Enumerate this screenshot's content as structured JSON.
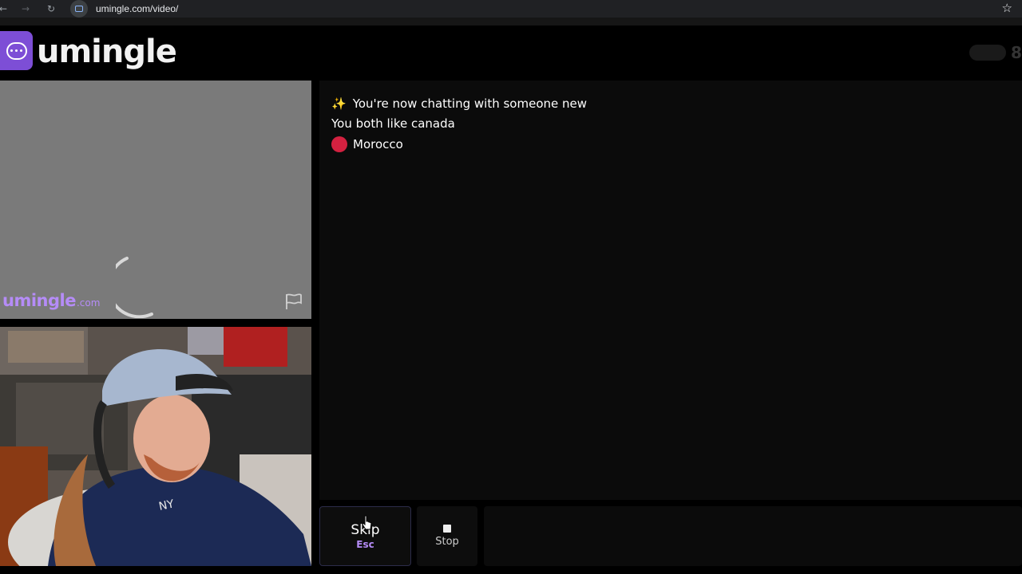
{
  "browser": {
    "url": "umingle.com/video/"
  },
  "header": {
    "logo_text": "umingle",
    "online_count": "8"
  },
  "stranger_video": {
    "watermark_main": "umingle",
    "watermark_suffix": ".com"
  },
  "chat": {
    "sparkle_icon": "✨",
    "line1": "You're now chatting with someone new",
    "line2": "You both like canada",
    "country": "Morocco",
    "country_color": "#d32140"
  },
  "controls": {
    "skip_label": "Skip",
    "skip_key": "Esc",
    "stop_label": "Stop"
  },
  "colors": {
    "accent": "#7d4ed6",
    "watermark": "#b58cf7"
  }
}
